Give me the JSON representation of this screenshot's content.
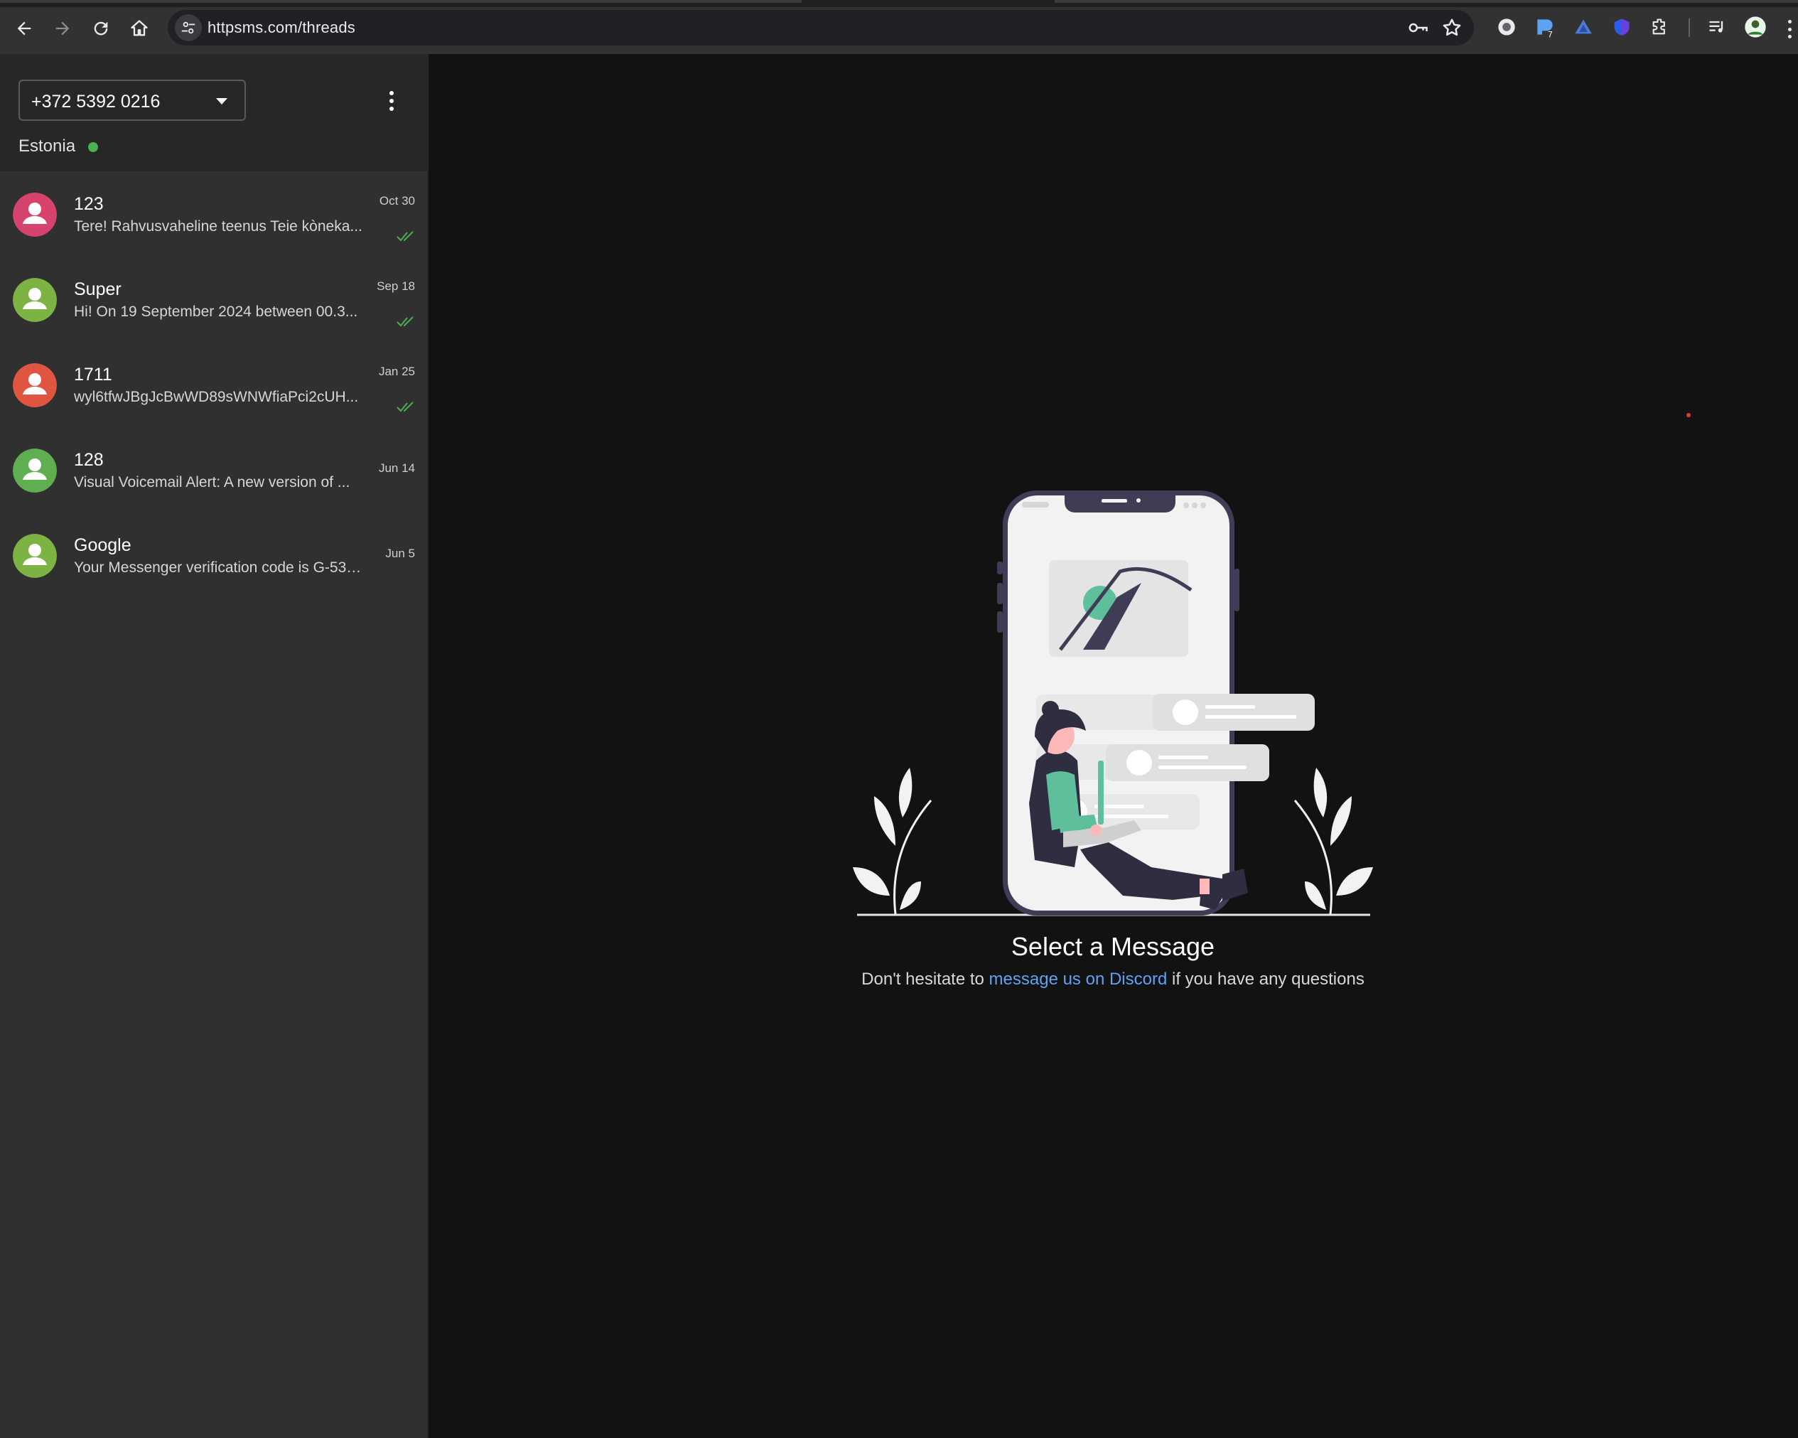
{
  "browser": {
    "url": "httpsms.com/threads",
    "extension_badge": "7"
  },
  "sidebar": {
    "phone_number": "+372 5392 0216",
    "country": "Estonia",
    "threads": [
      {
        "name": "123",
        "preview": "Tere! Rahvusvaheline teenus Teie kòneka...",
        "date": "Oct 30",
        "avatar_color": "#d6436c",
        "read": true
      },
      {
        "name": "Super",
        "preview": "Hi! On 19 September 2024 between 00.3...",
        "date": "Sep 18",
        "avatar_color": "#7cb342",
        "read": true
      },
      {
        "name": "1711",
        "preview": "wyl6tfwJBgJcBwWD89sWNWfiaPci2cUH...",
        "date": "Jan 25",
        "avatar_color": "#e0553f",
        "read": true
      },
      {
        "name": "128",
        "preview": "Visual Voicemail Alert: A new version of ...",
        "date": "Jun 14",
        "avatar_color": "#5fae4f",
        "read": false
      },
      {
        "name": "Google",
        "preview": "Your Messenger verification code is G-532...",
        "date": "Jun 5",
        "avatar_color": "#7cb342",
        "read": false
      }
    ]
  },
  "main": {
    "empty_title": "Select a Message",
    "empty_sub_before": "Don't hesitate to",
    "empty_sub_link": "message us on Discord",
    "empty_sub_after": "if you have any questions"
  },
  "colors": {
    "accent": "#5ea2f4",
    "online": "#4caf50",
    "read_check": "#4caf50"
  }
}
